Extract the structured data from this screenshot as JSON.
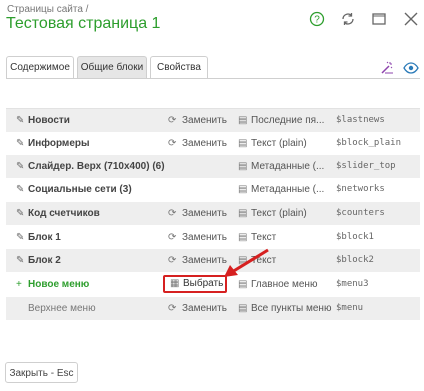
{
  "header": {
    "breadcrumb": "Страницы сайта /",
    "title": "Тестовая страница 1"
  },
  "tabs": [
    {
      "label": "Содержимое",
      "active": false
    },
    {
      "label": "Общие блоки",
      "active": true
    },
    {
      "label": "Свойства",
      "active": false
    }
  ],
  "rows": [
    {
      "name": "Новости",
      "action": "Заменить",
      "type": "Последние пя...",
      "var": "$lastnews"
    },
    {
      "name": "Информеры",
      "action": "Заменить",
      "type": "Текст (plain)",
      "var": "$block_plain"
    },
    {
      "name": "Слайдер. Верх (710x400) (6)",
      "action": "",
      "type": "Метаданные (...",
      "var": "$slider_top"
    },
    {
      "name": "Социальные сети (3)",
      "action": "",
      "type": "Метаданные (...",
      "var": "$networks"
    },
    {
      "name": "Код счетчиков",
      "action": "Заменить",
      "type": "Текст (plain)",
      "var": "$counters"
    },
    {
      "name": "Блок 1",
      "action": "Заменить",
      "type": "Текст",
      "var": "$block1"
    },
    {
      "name": "Блок 2",
      "action": "Заменить",
      "type": "Текст",
      "var": "$block2"
    },
    {
      "name": "Новое меню",
      "action": "Выбрать",
      "type": "Главное меню",
      "var": "$menu3"
    },
    {
      "name": "Верхнее меню",
      "action": "Заменить",
      "type": "Все пункты меню",
      "var": "$menu"
    }
  ],
  "footer": {
    "close_label": "Закрыть - Esc"
  },
  "colors": {
    "accent_green": "#2d9e2d",
    "highlight_red": "#d62020",
    "icon_purple": "#8e44ad",
    "icon_blue": "#2a7ab8"
  }
}
